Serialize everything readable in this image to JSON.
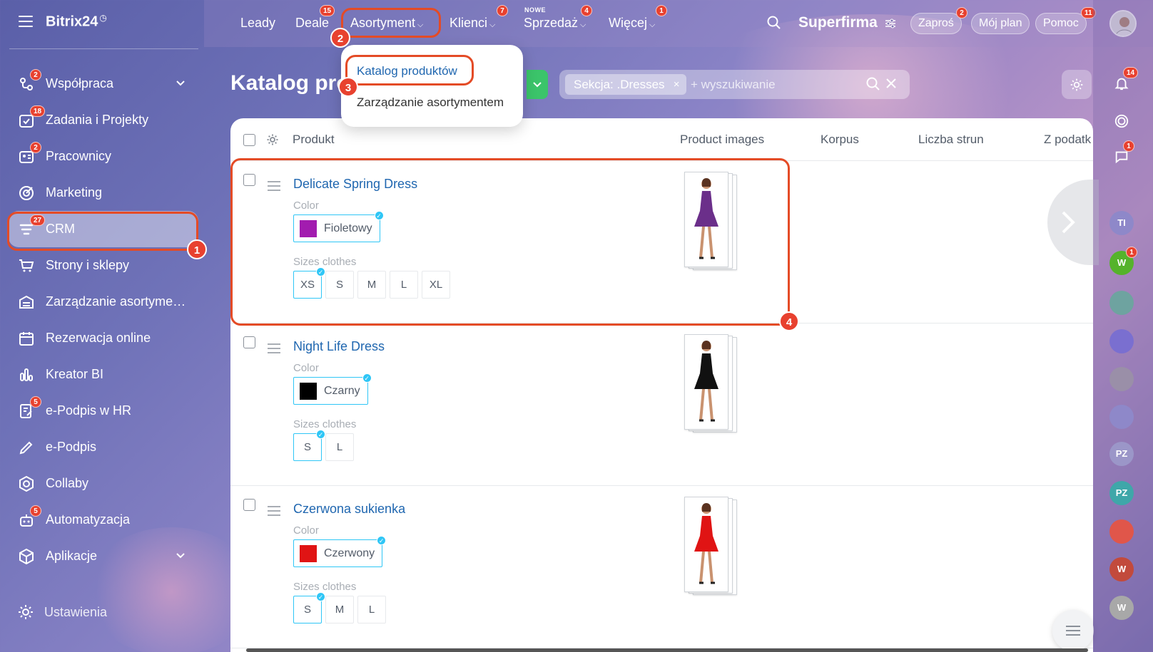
{
  "app": {
    "logo": "Bitrix24",
    "logo_mark": "◷"
  },
  "sidebar": {
    "items": [
      {
        "label": "Współpraca",
        "badge": "2",
        "icon": "collaboration-icon",
        "chevron": true
      },
      {
        "label": "Zadania i Projekty",
        "badge": "18",
        "icon": "tasks-icon"
      },
      {
        "label": "Pracownicy",
        "badge": "2",
        "icon": "employees-icon"
      },
      {
        "label": "Marketing",
        "badge": "",
        "icon": "marketing-icon"
      },
      {
        "label": "CRM",
        "badge": "27",
        "icon": "crm-icon",
        "active": true
      },
      {
        "label": "Strony i sklepy",
        "badge": "",
        "icon": "cart-icon"
      },
      {
        "label": "Zarządzanie asortymen...",
        "badge": "",
        "icon": "warehouse-icon"
      },
      {
        "label": "Rezerwacja online",
        "badge": "",
        "icon": "calendar-icon"
      },
      {
        "label": "Kreator BI",
        "badge": "",
        "icon": "bi-chart-icon"
      },
      {
        "label": "e-Podpis w HR",
        "badge": "5",
        "icon": "hr-sign-icon"
      },
      {
        "label": "e-Podpis",
        "badge": "",
        "icon": "pen-icon"
      },
      {
        "label": "Collaby",
        "badge": "",
        "icon": "hexagon-icon"
      },
      {
        "label": "Automatyzacja",
        "badge": "5",
        "icon": "robot-icon"
      },
      {
        "label": "Aplikacje",
        "badge": "",
        "icon": "cube-icon",
        "chevron": true
      }
    ],
    "settings_label": "Ustawienia"
  },
  "topnav": {
    "items": [
      {
        "label": "Leady",
        "badge": ""
      },
      {
        "label": "Deale",
        "badge": "15"
      },
      {
        "label": "Asortyment",
        "badge": "",
        "chevron": "⌵"
      },
      {
        "label": "Klienci",
        "badge": "7",
        "chevron": "⌵"
      },
      {
        "label": "Sprzedaż",
        "badge": "4",
        "chevron": "⌵"
      },
      {
        "label": "Więcej",
        "badge": "1",
        "chevron": "⌵"
      }
    ],
    "new_label": "NOWE",
    "company": "Superfirma",
    "invite": {
      "label": "Zaproś",
      "badge": "2"
    },
    "plan": "Mój plan",
    "help": {
      "label": "Pomoc",
      "badge": "11"
    }
  },
  "dropdown": {
    "items": [
      "Katalog produktów",
      "Zarządzanie asortymentem"
    ]
  },
  "page": {
    "title": "Katalog pro",
    "filter_chip": "Sekcja: .Dresses",
    "filter_chip_close": "×",
    "filter_placeholder": "+ wyszukiwanie"
  },
  "grid": {
    "columns": [
      "Produkt",
      "Product images",
      "Korpus",
      "Liczba strun",
      "Z podatk"
    ],
    "field_color": "Color",
    "field_sizes": "Sizes clothes",
    "rows": [
      {
        "name": "Delicate Spring Dress",
        "color": "Fioletowy",
        "swatch": "#a21caf",
        "sizes": [
          "XS",
          "S",
          "M",
          "L",
          "XL"
        ],
        "selected_size": "XS",
        "dress": "#6b2f8a"
      },
      {
        "name": "Night Life Dress",
        "color": "Czarny",
        "swatch": "#000000",
        "sizes": [
          "S",
          "L"
        ],
        "selected_size": "S",
        "dress": "#111111"
      },
      {
        "name": "Czerwona sukienka",
        "color": "Czerwony",
        "swatch": "#e01414",
        "sizes": [
          "S",
          "M",
          "L"
        ],
        "selected_size": "S",
        "dress": "#e01414"
      }
    ]
  },
  "steps": [
    "1",
    "2",
    "3",
    "4"
  ],
  "right_rail": {
    "notifications_badge": "14",
    "chat_badge": "1",
    "avatars": [
      {
        "initials": "TI",
        "color": "#8e88c9"
      },
      {
        "initials": "W",
        "color": "#55b32b",
        "badge": "1"
      },
      {
        "initials": "",
        "color": "#6ea3a0"
      },
      {
        "initials": "",
        "color": "#7a6fd0"
      },
      {
        "initials": "",
        "color": "#9a8fa8"
      },
      {
        "initials": "",
        "color": "#8e88c9"
      },
      {
        "initials": "PZ",
        "color": "#9b96c8"
      },
      {
        "initials": "PZ",
        "color": "#3fa7a9"
      },
      {
        "initials": "",
        "color": "#e0564a"
      },
      {
        "initials": "W",
        "color": "#c24a3c"
      },
      {
        "initials": "W",
        "color": "#a8a8a8"
      }
    ]
  },
  "colors": {
    "accent": "#2067b0",
    "highlight": "#e44b26",
    "badge": "#e8412f",
    "chip_border": "#2fc6f6"
  }
}
